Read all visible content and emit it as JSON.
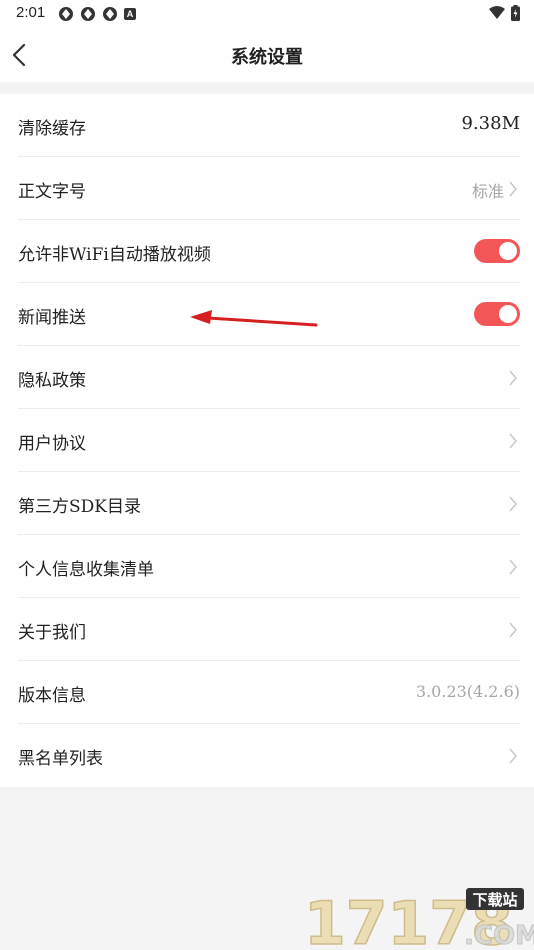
{
  "status_bar": {
    "time": "2:01",
    "notif_a_glyph": "A"
  },
  "header": {
    "title": "系统设置"
  },
  "settings": {
    "clear_cache": {
      "label": "清除缓存",
      "value": "9.38M"
    },
    "font_size": {
      "label": "正文字号",
      "value": "标准"
    },
    "autoplay_non_wifi": {
      "label": "允许非WiFi自动播放视频",
      "enabled": true
    },
    "news_push": {
      "label": "新闻推送",
      "enabled": true
    },
    "privacy_policy": {
      "label": "隐私政策"
    },
    "user_agreement": {
      "label": "用户协议"
    },
    "third_party_sdk": {
      "label": "第三方SDK目录"
    },
    "personal_info_list": {
      "label": "个人信息收集清单"
    },
    "about_us": {
      "label": "关于我们"
    },
    "version_info": {
      "label": "版本信息",
      "value": "3.0.23(4.2.6)"
    },
    "blacklist": {
      "label": "黑名单列表"
    }
  },
  "colors": {
    "accent": "#f35656",
    "annotation_arrow": "#d62020"
  },
  "watermark": {
    "number": "17178",
    "badge": "下载站",
    "suffix": ".COM"
  }
}
